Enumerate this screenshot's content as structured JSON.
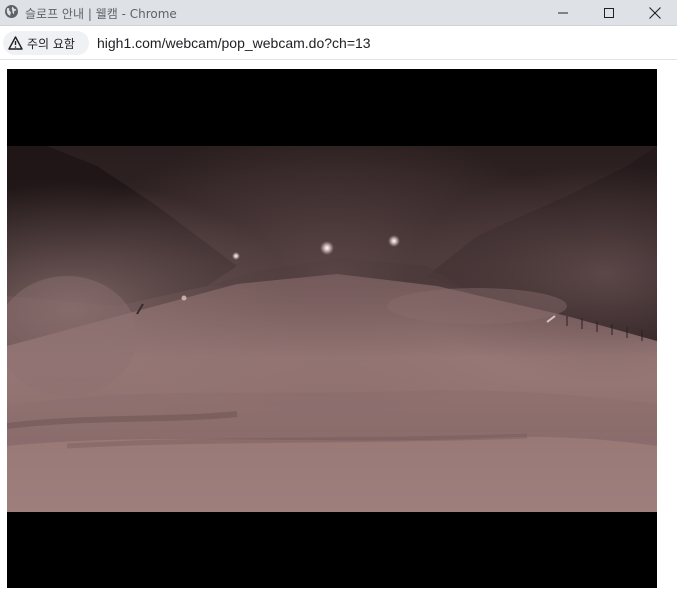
{
  "window": {
    "title": "슬로프 안내 | 웰캠 - Chrome",
    "icons": {
      "site": "globe-icon",
      "minimize": "minimize-icon",
      "maximize": "maximize-icon",
      "close": "close-icon"
    }
  },
  "address_bar": {
    "security_label": "주의 요함",
    "security_icon": "warning-icon",
    "url": "high1.com/webcam/pop_webcam.do?ch=13"
  },
  "colors": {
    "titlebar_bg": "#dee1e6",
    "chip_bg": "#eff1f4",
    "player_bg": "#000000",
    "frame_tint": "#6b4e4e"
  }
}
